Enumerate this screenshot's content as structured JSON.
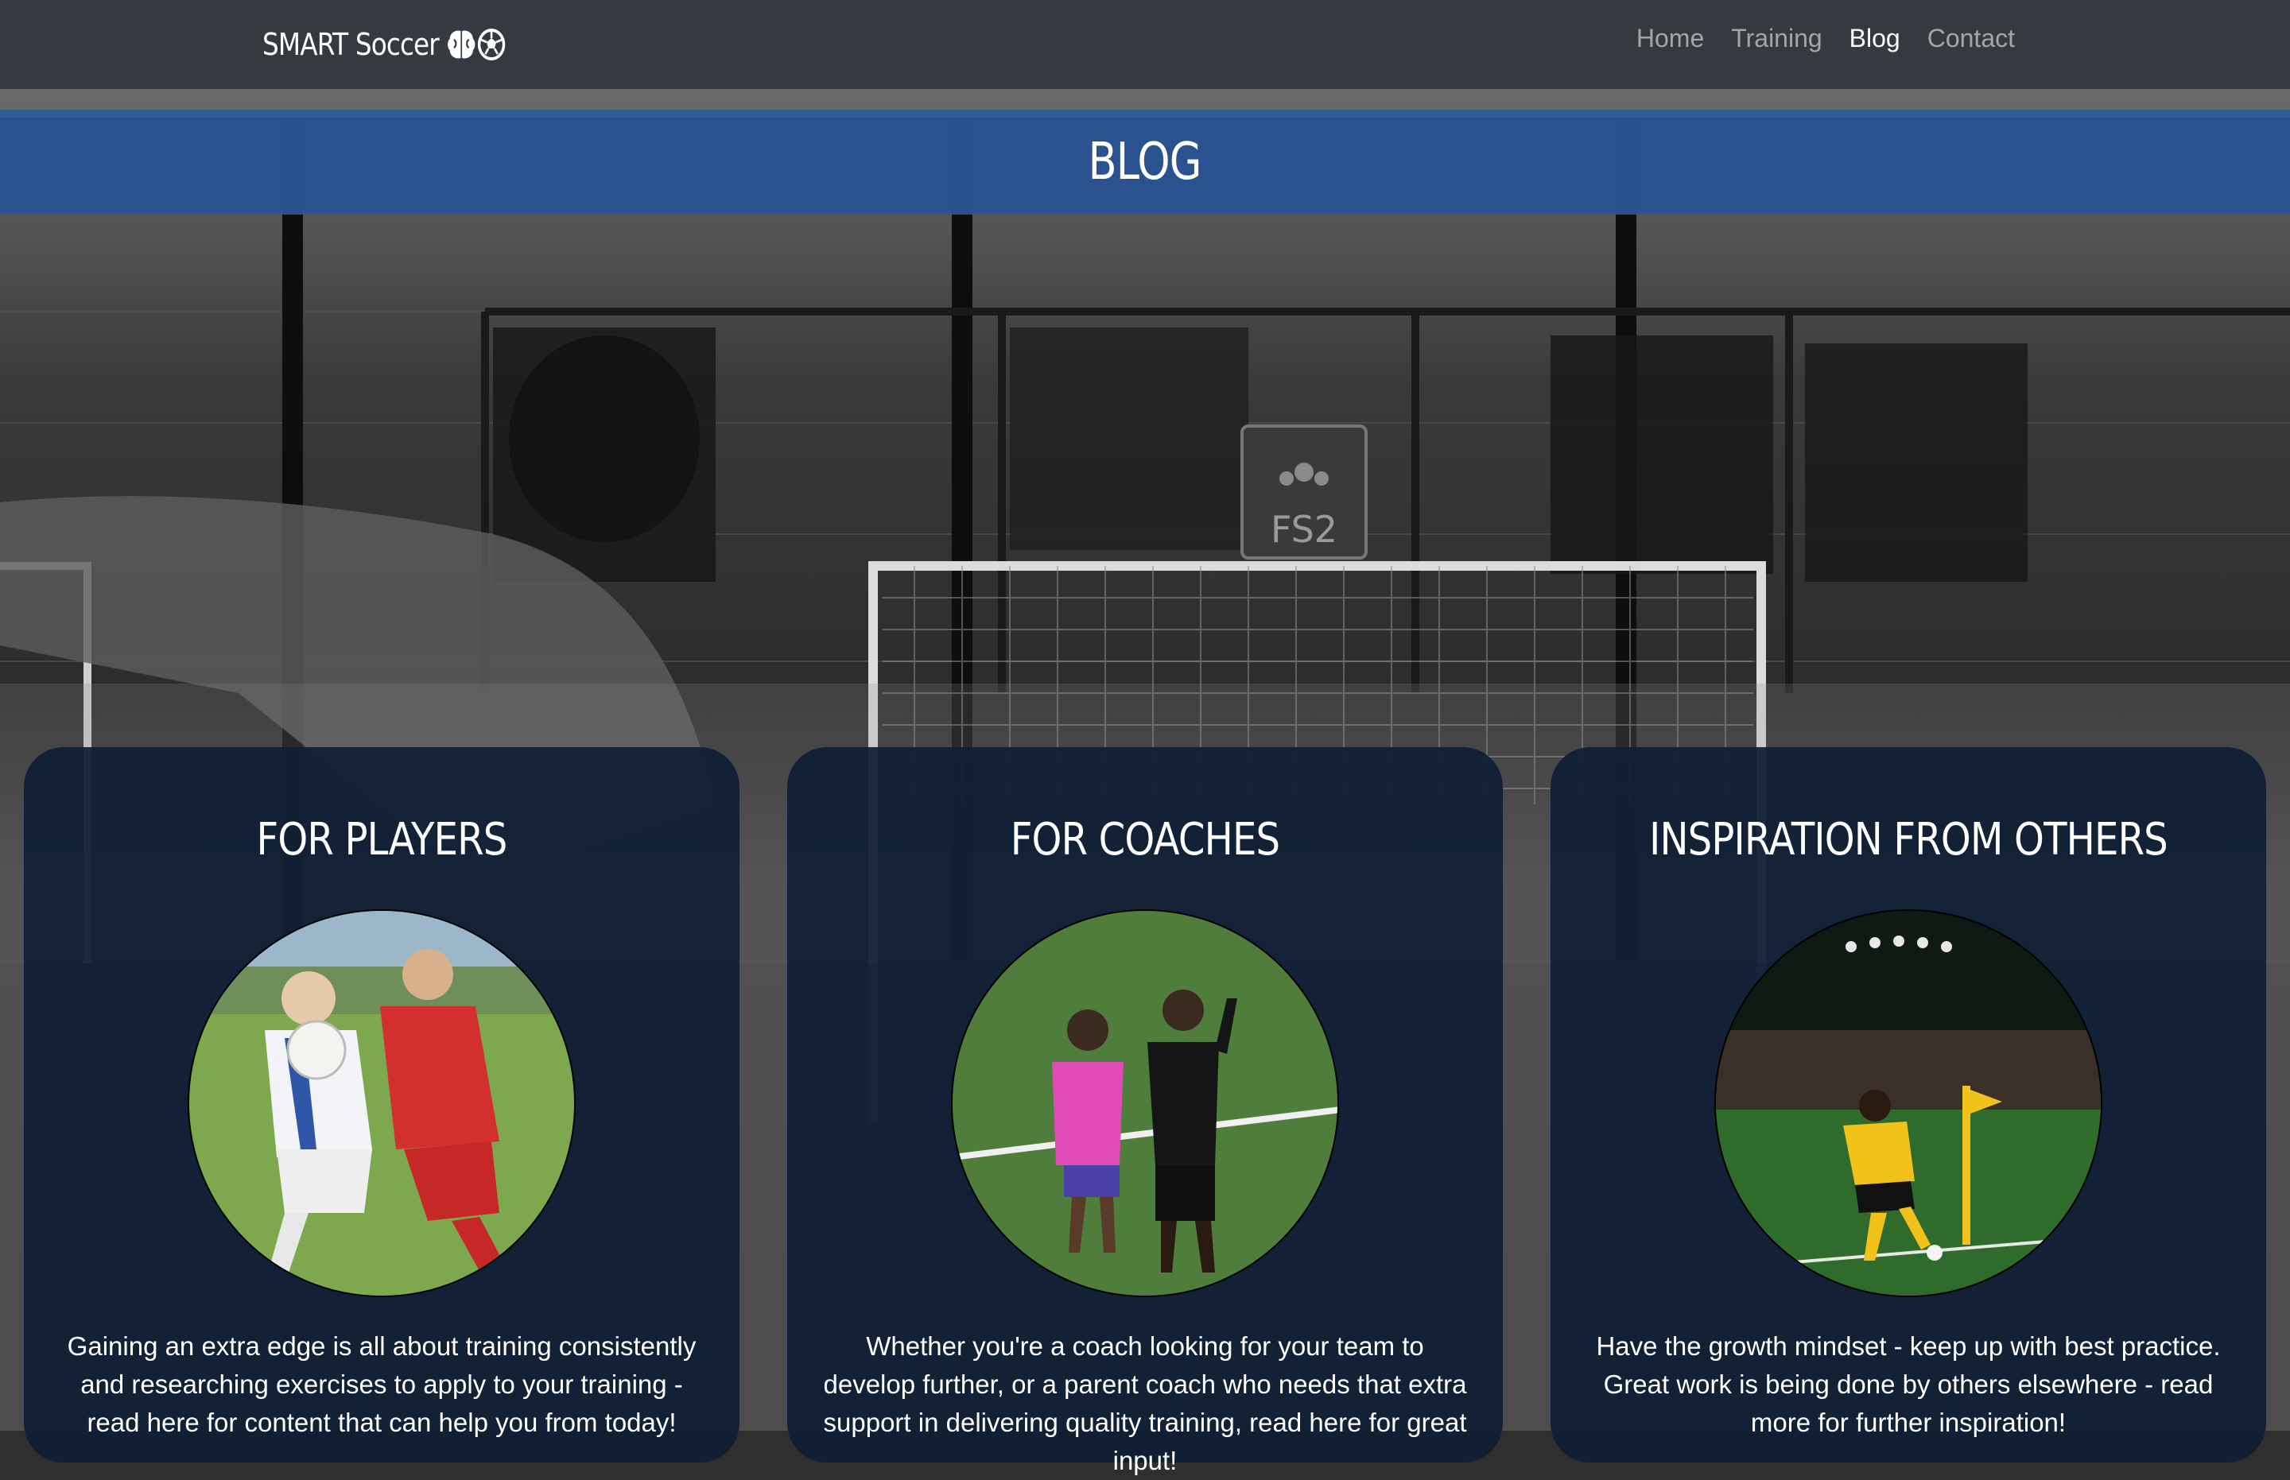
{
  "navbar": {
    "brand": "SMART Soccer",
    "brand_icons": [
      "brain-icon",
      "soccer-ball-icon"
    ],
    "links": [
      {
        "label": "Home",
        "active": false
      },
      {
        "label": "Training",
        "active": false
      },
      {
        "label": "Blog",
        "active": true
      },
      {
        "label": "Contact",
        "active": false
      }
    ]
  },
  "hero": {
    "sign_text": "FS2"
  },
  "page": {
    "title": "BLOG"
  },
  "cards": [
    {
      "title": "FOR PLAYERS",
      "text": "Gaining an extra edge is all about training consistently and researching exercises to apply to your training - read here for content that can help you from today!"
    },
    {
      "title": "FOR COACHES",
      "text": "Whether you're a coach looking for your team to develop further, or a parent coach who needs that extra support in delivering quality training, read here for great input!"
    },
    {
      "title": "INSPIRATION FROM OTHERS",
      "text": "Have the growth mindset - keep up with best practice. Great work is being done by others elsewhere - read more for further inspiration!"
    }
  ],
  "colors": {
    "navbar_bg": "#343a40",
    "title_band": "#2c5a9e",
    "card_bg": "#0e1e34"
  }
}
